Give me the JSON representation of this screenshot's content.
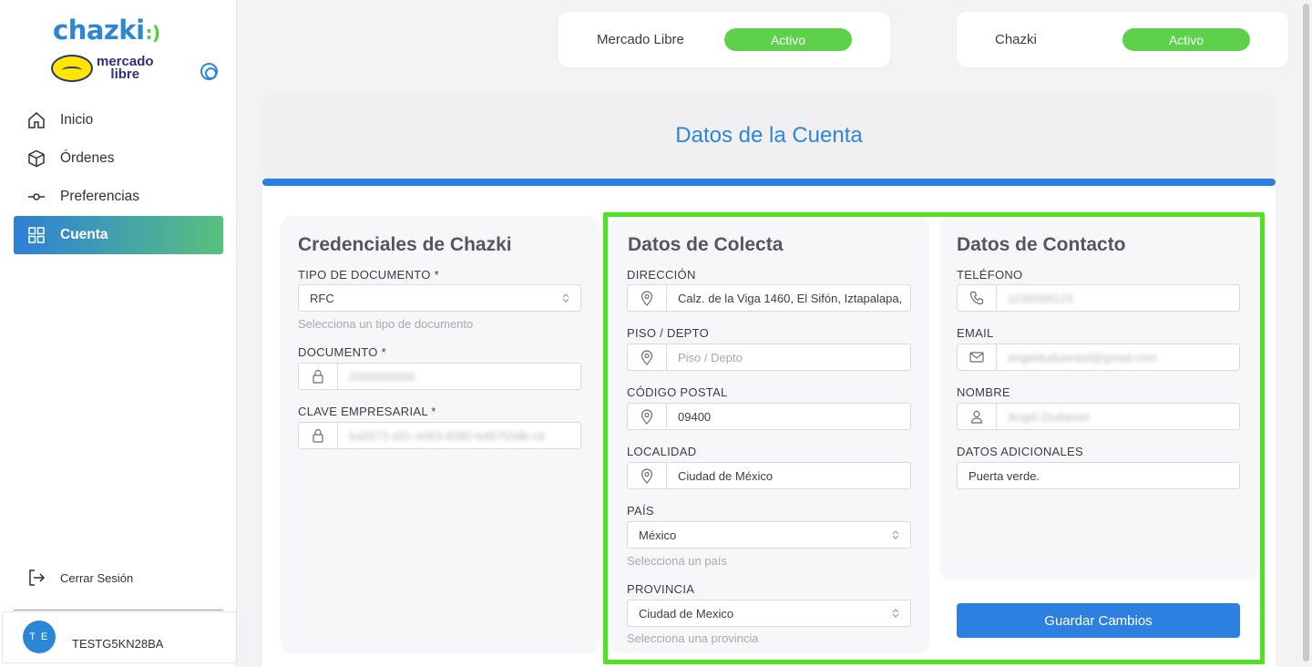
{
  "sidebar": {
    "logo_main": "chazki",
    "logo_partner_line1": "mercado",
    "logo_partner_line2": "libre",
    "nav": [
      {
        "label": "Inicio",
        "icon": "home-icon"
      },
      {
        "label": "Órdenes",
        "icon": "package-icon"
      },
      {
        "label": "Preferencias",
        "icon": "sliders-icon"
      },
      {
        "label": "Cuenta",
        "icon": "grid-icon",
        "active": true
      }
    ],
    "logout_label": "Cerrar Sesión",
    "user": {
      "initials": "T E",
      "name": "TESTG5KN28BA"
    }
  },
  "status": [
    {
      "label": "Mercado Libre",
      "state": "Activo"
    },
    {
      "label": "Chazki",
      "state": "Activo"
    }
  ],
  "main": {
    "title": "Datos de la Cuenta",
    "credenciales": {
      "title": "Credenciales de Chazki",
      "tipo_label": "TIPO DE DOCUMENTO *",
      "tipo_value": "RFC",
      "tipo_help": "Selecciona un tipo de documento",
      "documento_label": "DOCUMENTO *",
      "documento_value": "2000000009",
      "clave_label": "CLAVE EMPRESARIAL *",
      "clave_value": "ba5672-d2c-4063-8080-b46750db-c6"
    },
    "colecta": {
      "title": "Datos de Colecta",
      "direccion_label": "DIRECCIÓN",
      "direccion_value": "Calz. de la Viga 1460, El Sifón, Iztapalapa,",
      "piso_label": "PISO / DEPTO",
      "piso_placeholder": "Piso / Depto",
      "cp_label": "CÓDIGO POSTAL",
      "cp_value": "09400",
      "localidad_label": "LOCALIDAD",
      "localidad_value": "Ciudad de México",
      "pais_label": "PAÍS",
      "pais_value": "México",
      "pais_help": "Selecciona un país",
      "provincia_label": "PROVINCIA",
      "provincia_value": "Ciudad de Mexico",
      "provincia_help": "Selecciona una provincia"
    },
    "contacto": {
      "title": "Datos de Contacto",
      "telefono_label": "TELÉFONO",
      "telefono_value": "1156568123",
      "email_label": "EMAIL",
      "email_value": "angelduduenasl@gmail.com",
      "nombre_label": "NOMBRE",
      "nombre_value": "Angel Dudamel",
      "adicionales_label": "DATOS ADICIONALES",
      "adicionales_value": "Puerta verde."
    },
    "save_label": "Guardar Cambios"
  },
  "colors": {
    "primary": "#2d7fe0",
    "success": "#5ed14b",
    "highlight": "#4de31e"
  }
}
